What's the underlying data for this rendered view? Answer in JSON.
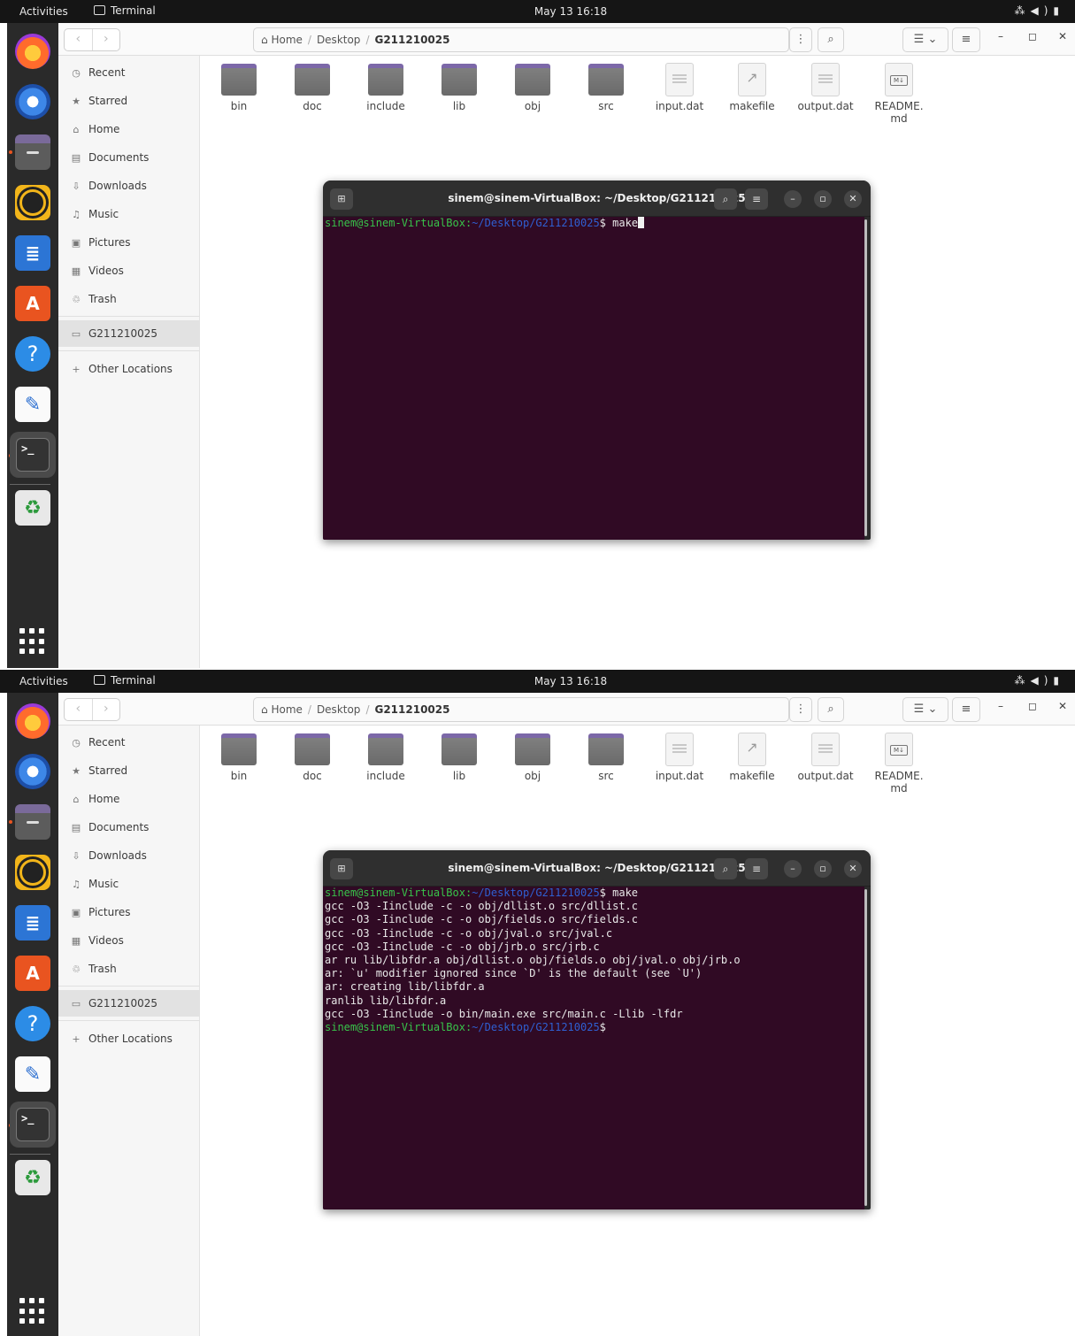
{
  "topbar": {
    "activities": "Activities",
    "app_name": "Terminal",
    "clock": "May 13  16:18"
  },
  "nav": {
    "back": "‹",
    "forward": "›"
  },
  "breadcrumb": {
    "home": "Home",
    "separator": "/",
    "desktop": "Desktop",
    "current": "G211210025"
  },
  "sidebar": {
    "recent": "Recent",
    "starred": "Starred",
    "home": "Home",
    "documents": "Documents",
    "downloads": "Downloads",
    "music": "Music",
    "pictures": "Pictures",
    "videos": "Videos",
    "trash": "Trash",
    "folder": "G211210025",
    "other": "Other Locations"
  },
  "files": {
    "f0": "bin",
    "f1": "doc",
    "f2": "include",
    "f3": "lib",
    "f4": "obj",
    "f5": "src",
    "f6": "input.dat",
    "f7": "makefile",
    "f8": "output.dat",
    "f9a": "README.",
    "f9b": "md"
  },
  "terminal": {
    "title": "sinem@sinem-VirtualBox: ~/Desktop/G211210025",
    "prompt_user": "sinem@sinem-VirtualBox:",
    "prompt_path": "~/Desktop/G211210025",
    "prompt_end": "$ ",
    "command": "make",
    "output": [
      "gcc -O3 -Iinclude -c -o obj/dllist.o src/dllist.c",
      "gcc -O3 -Iinclude -c -o obj/fields.o src/fields.c",
      "gcc -O3 -Iinclude -c -o obj/jval.o src/jval.c",
      "gcc -O3 -Iinclude -c -o obj/jrb.o src/jrb.c",
      "ar ru lib/libfdr.a obj/dllist.o obj/fields.o obj/jval.o obj/jrb.o",
      "ar: `u' modifier ignored since `D' is the default (see `U')",
      "ar: creating lib/libfdr.a",
      "ranlib lib/libfdr.a",
      "gcc -O3 -Iinclude -o bin/main.exe src/main.c -Llib -lfdr"
    ],
    "final_prompt_end": "$"
  },
  "icons": {
    "tray": [
      "network-icon",
      "volume-icon",
      "battery-icon"
    ],
    "dock": [
      "firefox-icon",
      "thunderbird-icon",
      "files-icon",
      "rhythmbox-icon",
      "writer-icon",
      "app-store-icon",
      "help-icon",
      "text-editor-icon",
      "terminal-icon",
      "trash-icon",
      "show-apps-icon"
    ]
  },
  "colors": {
    "terminal_bg": "#300a24",
    "prompt_user": "#38c34a",
    "prompt_path": "#2f5fd1",
    "topbar": "#151515",
    "dock": "#2a2a2a",
    "accent": "#e95420"
  }
}
